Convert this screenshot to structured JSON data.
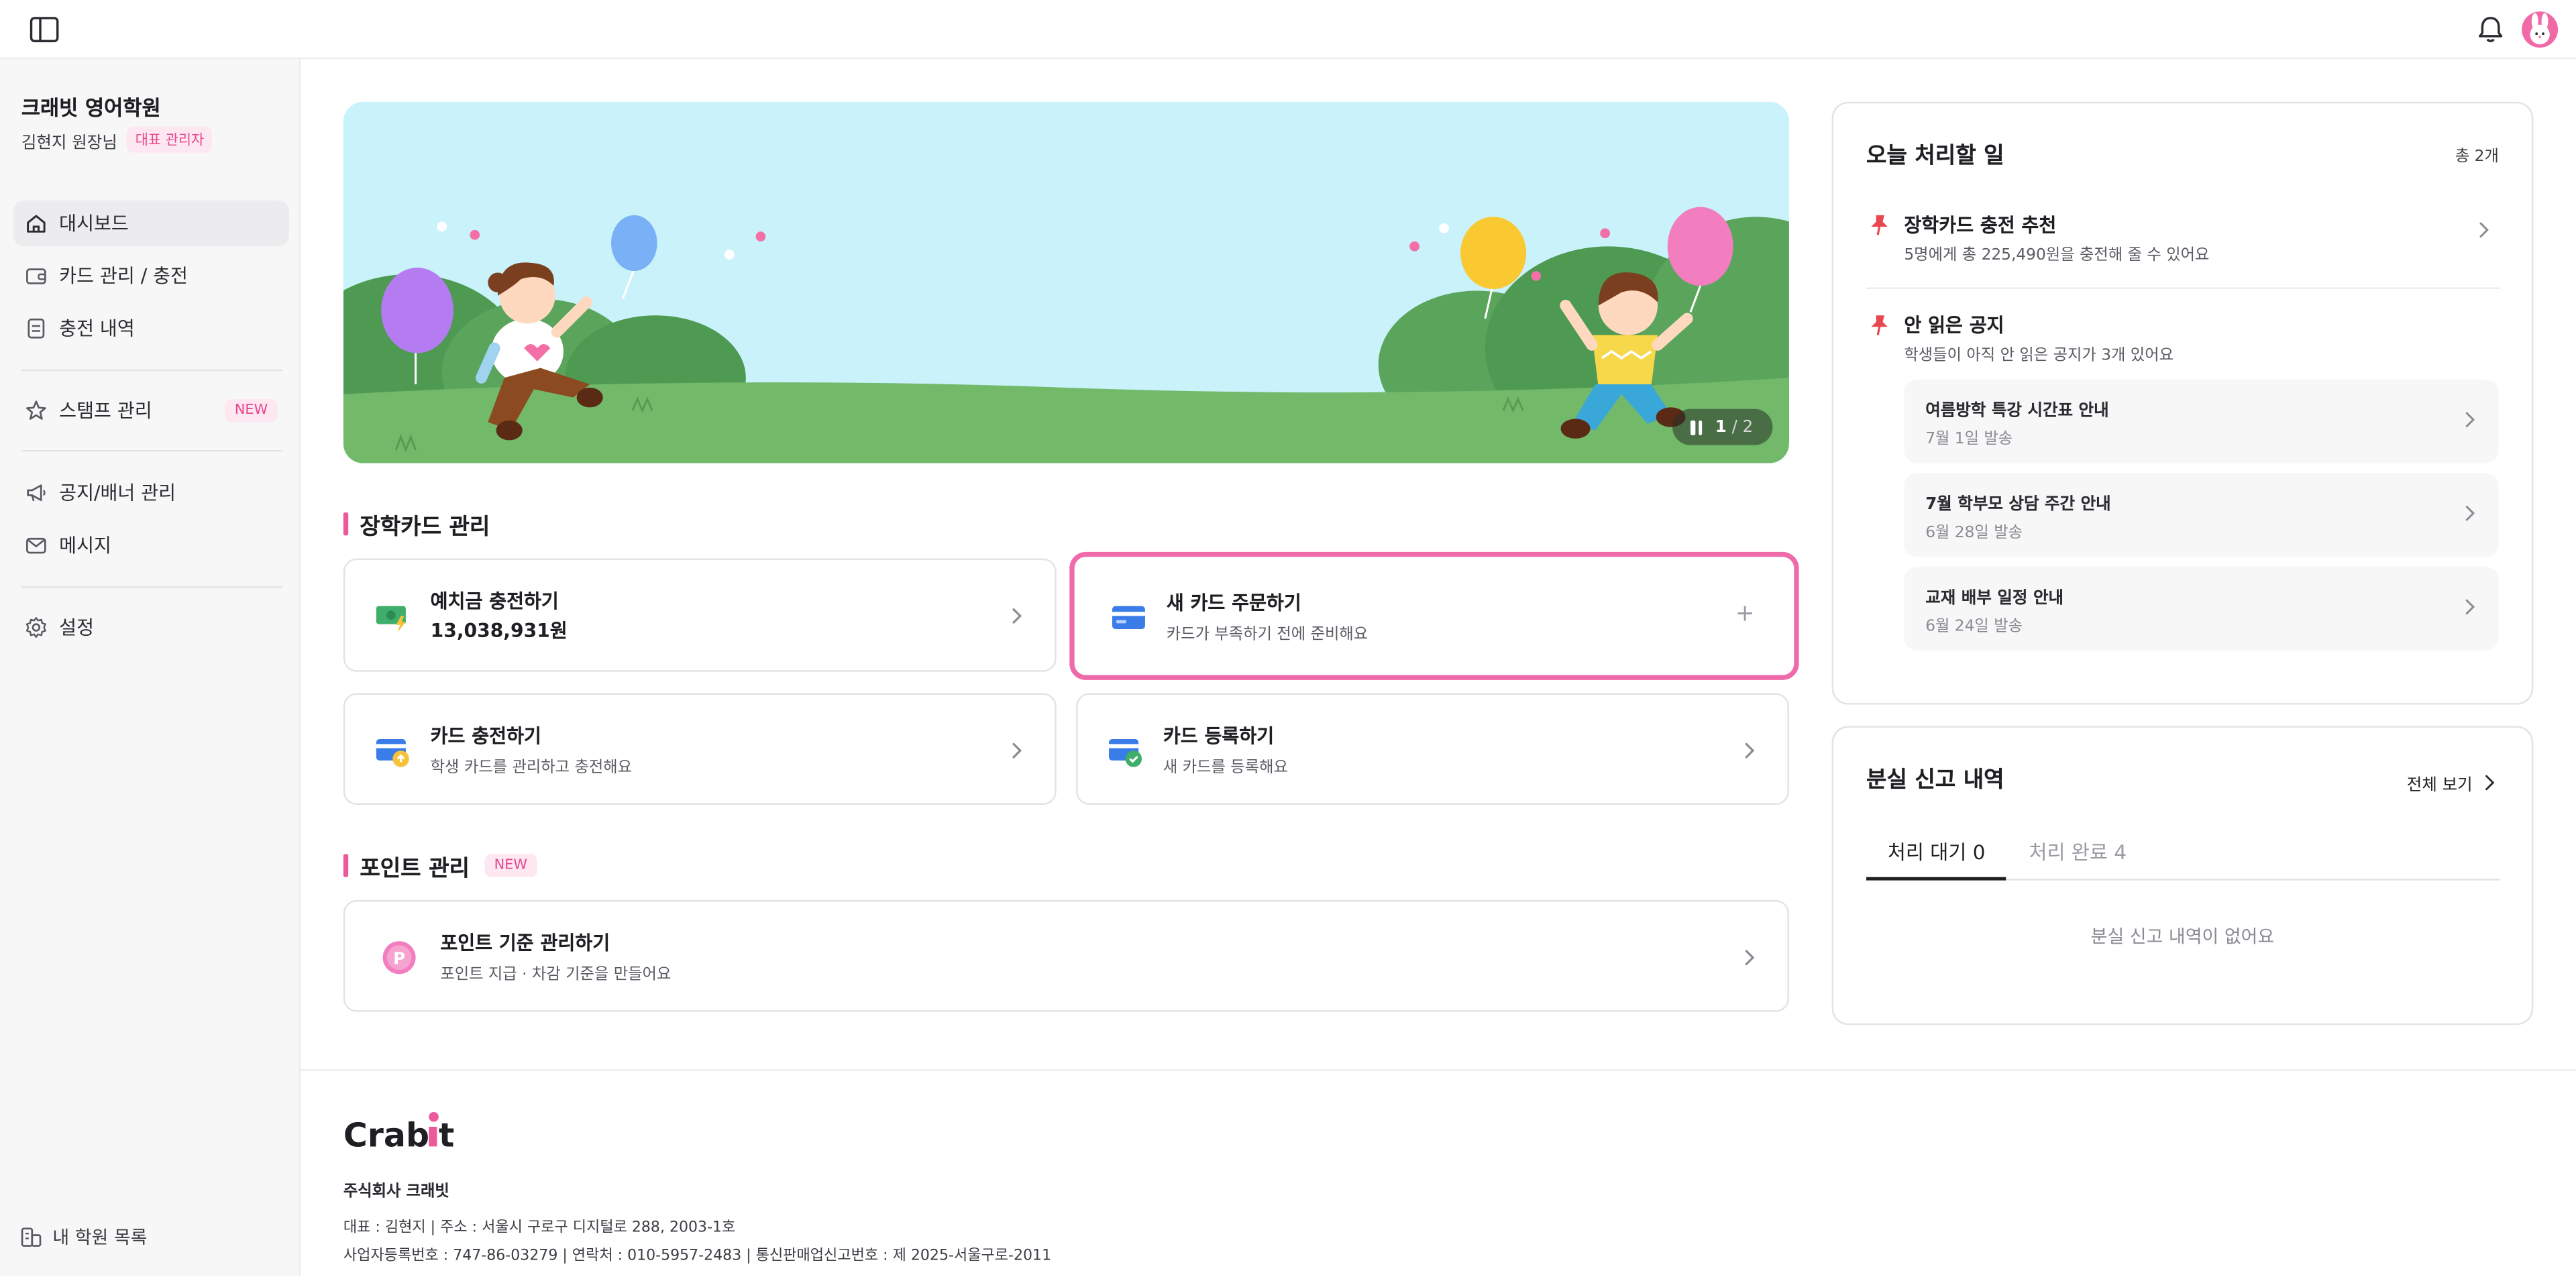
{
  "topbar": {
    "sidebar_toggle_icon": "sidebar-toggle-icon",
    "notification_icon": "bell-icon",
    "avatar_icon": "rabbit-avatar"
  },
  "sidebar": {
    "academy_name": "크래빗 영어학원",
    "owner_name": "김현지 원장님",
    "role_badge": "대표 관리자",
    "items": [
      {
        "label": "대시보드",
        "icon": "home-icon",
        "active": true
      },
      {
        "label": "카드 관리 / 충전",
        "icon": "wallet-icon"
      },
      {
        "label": "충전 내역",
        "icon": "receipt-icon"
      },
      {
        "label": "스탬프 관리",
        "icon": "star-icon",
        "badge": "NEW"
      },
      {
        "label": "공지/배너 관리",
        "icon": "megaphone-icon"
      },
      {
        "label": "메시지",
        "icon": "mail-icon"
      },
      {
        "label": "설정",
        "icon": "gear-icon"
      }
    ],
    "bottom_link": "내 학원 목록"
  },
  "banner": {
    "current": "1",
    "total": "/ 2"
  },
  "scholarship": {
    "title": "장학카드 관리",
    "cards": [
      {
        "title": "예치금 충전하기",
        "sub": "13,038,931원",
        "icon": "money-charge-icon",
        "action": "chevron"
      },
      {
        "title": "새 카드 주문하기",
        "sub": "카드가 부족하기 전에 준비해요",
        "icon": "credit-card-icon",
        "action": "plus"
      },
      {
        "title": "카드 충전하기",
        "sub": "학생 카드를 관리하고 충전해요",
        "icon": "card-charge-icon",
        "action": "chevron"
      },
      {
        "title": "카드 등록하기",
        "sub": "새 카드를 등록해요",
        "icon": "card-check-icon",
        "action": "chevron"
      }
    ]
  },
  "points": {
    "title": "포인트 관리",
    "badge": "NEW",
    "card": {
      "title": "포인트 기준 관리하기",
      "sub": "포인트 지급 · 차감 기준을 만들어요",
      "icon": "point-p-icon"
    }
  },
  "today": {
    "title": "오늘 처리할 일",
    "count": "총 2개",
    "tasks": [
      {
        "title": "장학카드 충전 추천",
        "sub": "5명에게 총 225,490원을 충전해 줄 수 있어요"
      },
      {
        "title": "안 읽은 공지",
        "sub": "학생들이 아직 안 읽은 공지가 3개 있어요"
      }
    ],
    "notices": [
      {
        "title": "여름방학 특강 시간표 안내",
        "date": "7월 1일 발송"
      },
      {
        "title": "7월 학부모 상담 주간 안내",
        "date": "6월 28일 발송"
      },
      {
        "title": "교재 배부 일정 안내",
        "date": "6월 24일 발송"
      }
    ]
  },
  "lost": {
    "title": "분실 신고 내역",
    "view_all": "전체 보기",
    "tabs": [
      {
        "label": "처리 대기 0",
        "active": true
      },
      {
        "label": "처리 완료 4",
        "active": false
      }
    ],
    "empty": "분실 신고 내역이 없어요"
  },
  "footer": {
    "logo": "Crabit",
    "company": "주식회사 크래빗",
    "line1": "대표 : 김현지 | 주소 : 서울시 구로구 디지털로 288, 2003-1호",
    "line2": "사업자등록번호 : 747-86-03279 | 연락처 : 010-5957-2483 | 통신판매업신고번호 : 제 2025-서울구로-2011"
  },
  "colors": {
    "accent": "#ec5a9c",
    "badge_bg": "#fde7f1",
    "banner_sky": "#c9f2fb",
    "banner_grass": "#72b96a"
  }
}
